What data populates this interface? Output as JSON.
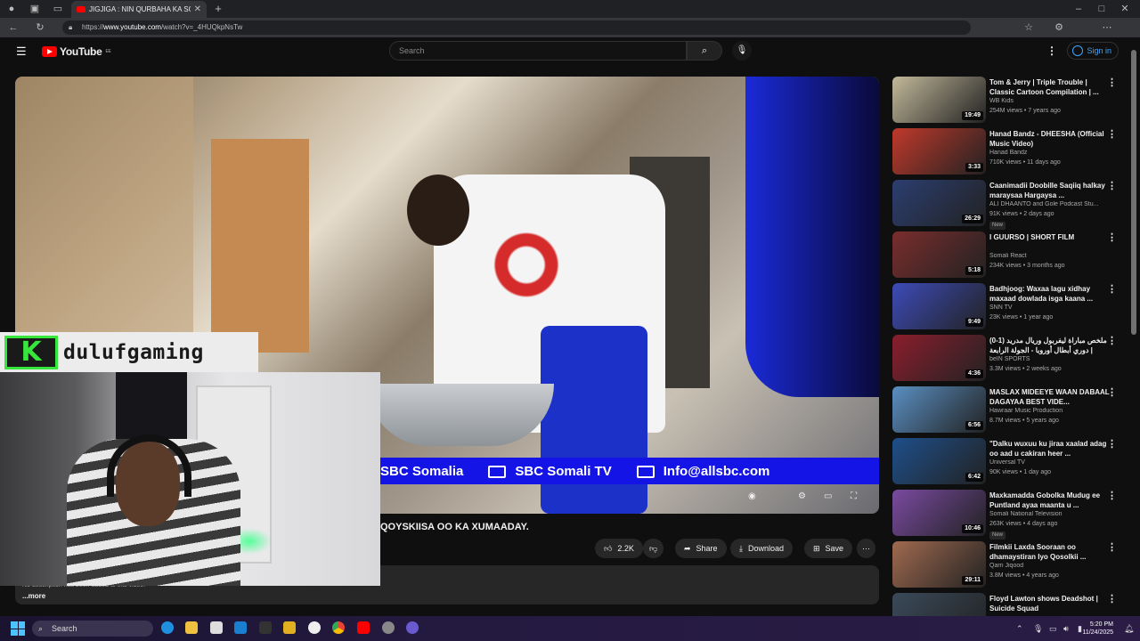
{
  "browser": {
    "tab_title": "JIGJIGA : NIN QURBAHA KA SOO",
    "url_prefix": "https://",
    "url_host": "www.youtube.com",
    "url_path": "/watch?v=_4HUQkpNsTw"
  },
  "header": {
    "logo_text": "YouTube",
    "logo_region": "EE",
    "search_placeholder": "Search",
    "signin_label": "Sign in"
  },
  "video": {
    "banner_left": "SBC Somalia",
    "banner_middle": "SBC Somali TV",
    "banner_right": "Info@allsbc.com",
    "title_fragment": "QOYSKIISA OO KA XUMAADAY.",
    "webcam_brand": "dulufgaming",
    "webcam_logo_letter": "K"
  },
  "actions": {
    "likes": "2.2K",
    "share": "Share",
    "download": "Download",
    "save": "Save"
  },
  "description": {
    "text": "No description has been added to this video.",
    "more": "...more"
  },
  "recommendations": [
    {
      "title": "Tom & Jerry | Triple Trouble | Classic Cartoon Compilation | ...",
      "channel": "WB Kids",
      "meta": "254M views • 7 years ago",
      "duration": "19:49",
      "color": "#c2b89a",
      "new": ""
    },
    {
      "title": "Hanad Bandz - DHEESHA (Official Music Video)",
      "channel": "Hanad Bandz",
      "meta": "710K views • 11 days ago",
      "duration": "3:33",
      "color": "#c0392b",
      "new": ""
    },
    {
      "title": "Caanimadii Doobille Saqiiq halkay maraysaa Hargaysa ...",
      "channel": "ALI DHAANTO  and Gole Podcast Stu...",
      "meta": "91K views • 2 days ago",
      "duration": "26:29",
      "color": "#2c3e70",
      "new": "New"
    },
    {
      "title": "I GUURSO | SHORT FILM",
      "channel": "Somali React",
      "meta": "234K views • 3 months ago",
      "duration": "5:18",
      "color": "#7a2d2d",
      "new": ""
    },
    {
      "title": "Badhjoog: Waxaa lagu xidhay maxaad dowlada isga kaana ...",
      "channel": "SNN TV",
      "meta": "23K views • 1 year ago",
      "duration": "9:49",
      "color": "#3d4bb8",
      "new": ""
    },
    {
      "title": "ملخص مباراة ليفربول وريال مدريد (1-0) | دوري أبطال أوروبا - الجولة الرابعة",
      "channel": "beIN SPORTS",
      "meta": "3.3M views • 2 weeks ago",
      "duration": "4:36",
      "color": "#8b1e2d",
      "new": ""
    },
    {
      "title": "MASLAX MIDEEYE WAAN DABAAL DAGAYAA BEST VIDE...",
      "channel": "Hawraar Music Production",
      "meta": "8.7M views • 5 years ago",
      "duration": "6:56",
      "color": "#5a8fc2",
      "new": ""
    },
    {
      "title": "\"Dalku wuxuu ku jiraa xaalad adag oo aad u cakiran heer ...",
      "channel": "Universal TV",
      "meta": "90K views • 1 day ago",
      "duration": "6:42",
      "color": "#1e4f8a",
      "new": ""
    },
    {
      "title": "Maxkamadda Gobolka Mudug ee Puntland ayaa maanta u ...",
      "channel": "Somali National Television",
      "meta": "263K views • 4 days ago",
      "duration": "10:46",
      "color": "#7a4aa0",
      "new": "New"
    },
    {
      "title": "Filmkii Laxda Sooraan oo dhamaystiran Iyo Qosolkii ...",
      "channel": "Qarri Jiqood",
      "meta": "3.8M views • 4 years ago",
      "duration": "29:11",
      "color": "#a06a50",
      "new": ""
    },
    {
      "title": "Floyd Lawton shows Deadshot | Suicide Squad",
      "channel": "",
      "meta": "",
      "duration": "",
      "color": "#3a4a5a",
      "new": ""
    }
  ],
  "taskbar": {
    "search": "Search",
    "time": "5:20 PM",
    "date": "11/24/2025"
  }
}
